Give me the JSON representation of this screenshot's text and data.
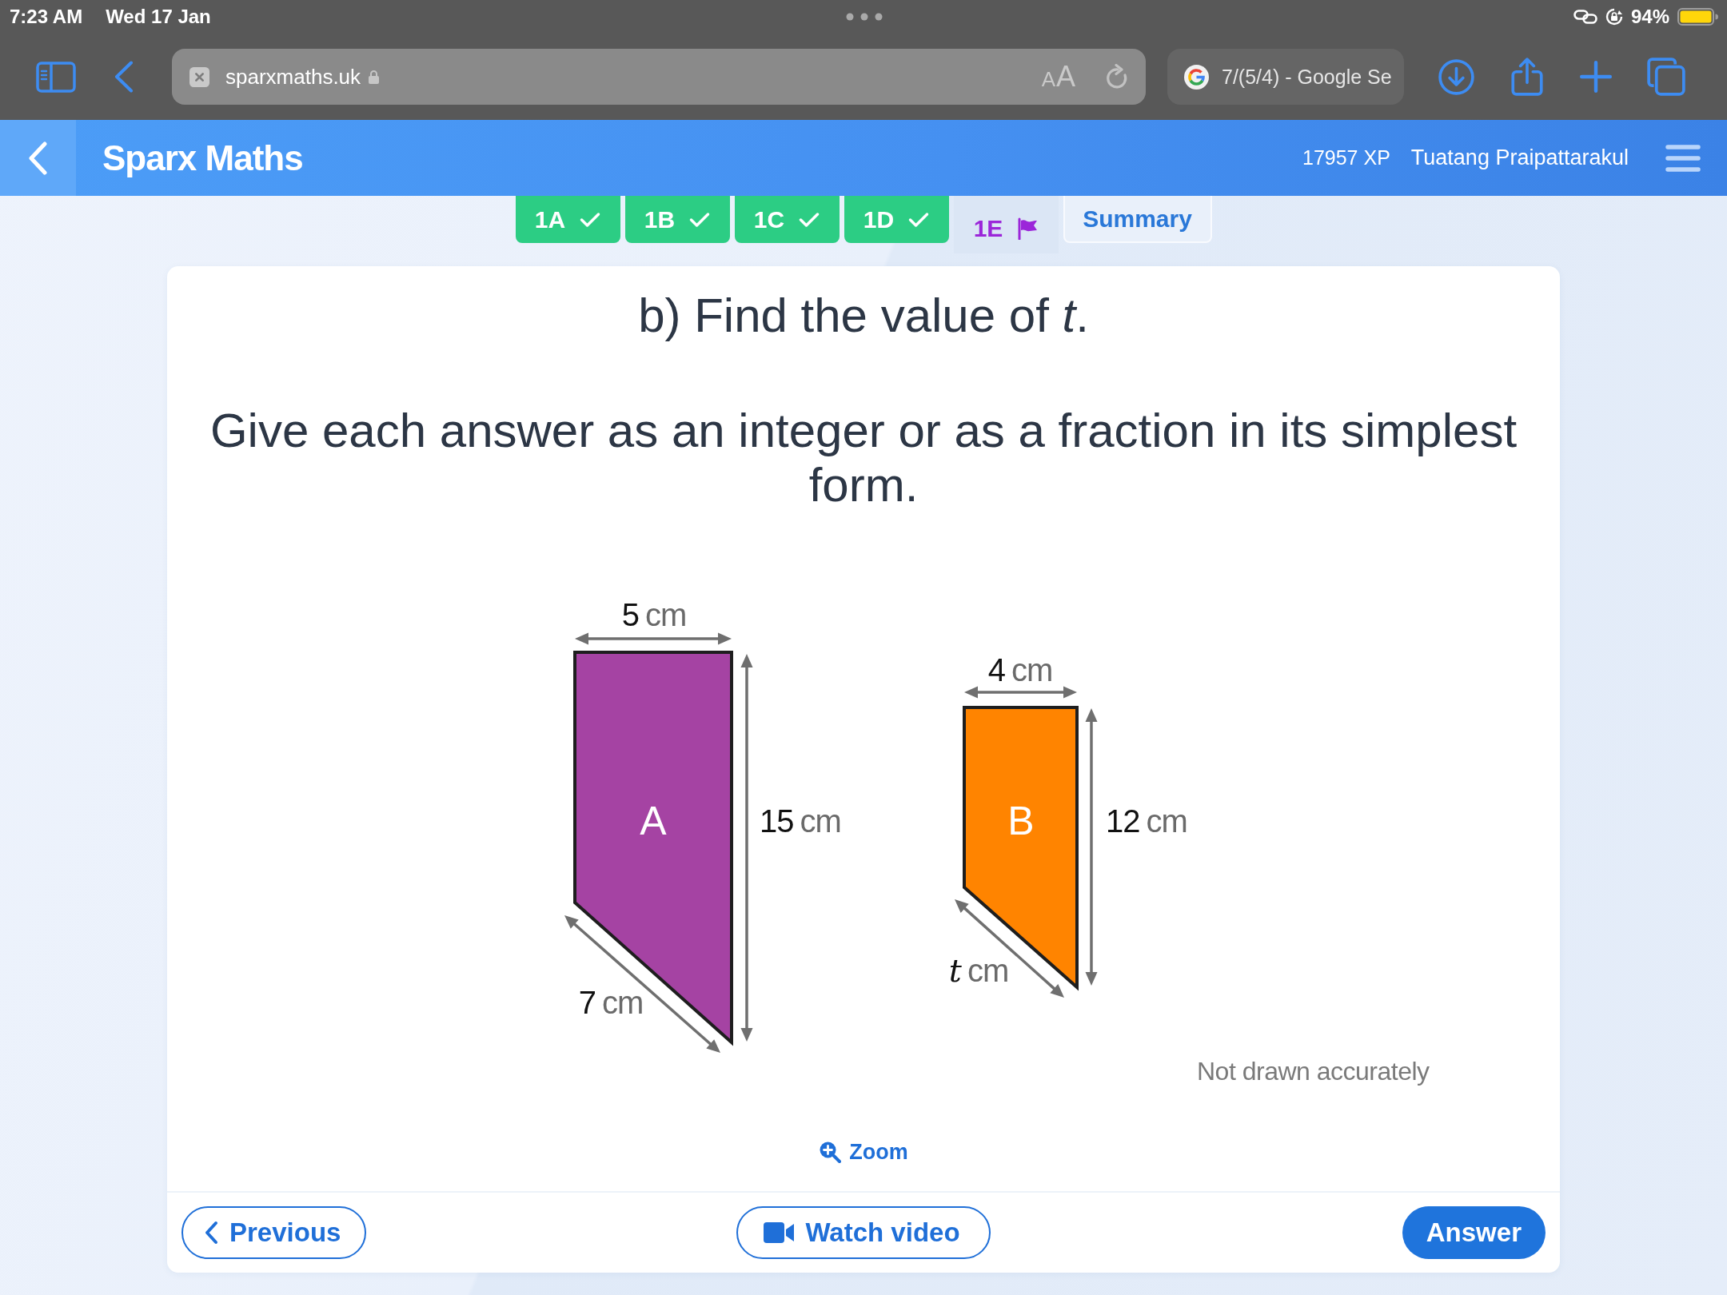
{
  "status_bar": {
    "time": "7:23 AM",
    "date": "Wed 17 Jan",
    "battery": "94%"
  },
  "browser": {
    "address": "sparxmaths.uk",
    "page_menu": "AA",
    "other_tab": "7/(5/4) - Google Se"
  },
  "header": {
    "title": "Sparx Maths",
    "xp": "17957 XP",
    "user": "Tuatang Praipattarakul"
  },
  "tabs": [
    {
      "label": "1A",
      "kind": "done",
      "selected": false
    },
    {
      "label": "1B",
      "kind": "done",
      "selected": false
    },
    {
      "label": "1C",
      "kind": "done",
      "selected": false
    },
    {
      "label": "1D",
      "kind": "done",
      "selected": false
    },
    {
      "label": "1E",
      "kind": "flagged",
      "selected": true
    },
    {
      "label": "Summary",
      "kind": "summary",
      "selected": false
    }
  ],
  "question": {
    "prompt": "b) Find the value of *t*.",
    "instruction": "Give each answer as an integer or as a fraction in its simplest form."
  },
  "figure": {
    "shapes": [
      {
        "label": "A",
        "color": "#a543a3",
        "top": {
          "value": "5",
          "unit": "cm",
          "kind": "number"
        },
        "side": {
          "value": "15",
          "unit": "cm",
          "kind": "number"
        },
        "slant": {
          "value": "7",
          "unit": "cm",
          "kind": "number"
        }
      },
      {
        "label": "B",
        "color": "#ff8400",
        "top": {
          "value": "4",
          "unit": "cm",
          "kind": "number"
        },
        "side": {
          "value": "12",
          "unit": "cm",
          "kind": "number"
        },
        "slant": {
          "value": "t",
          "unit": "cm",
          "kind": "variable"
        }
      }
    ],
    "note": "Not drawn accurately"
  },
  "zoom_link": "Zoom",
  "footer": {
    "previous": "Previous",
    "watch_video": "Watch video",
    "answer": "Answer"
  }
}
